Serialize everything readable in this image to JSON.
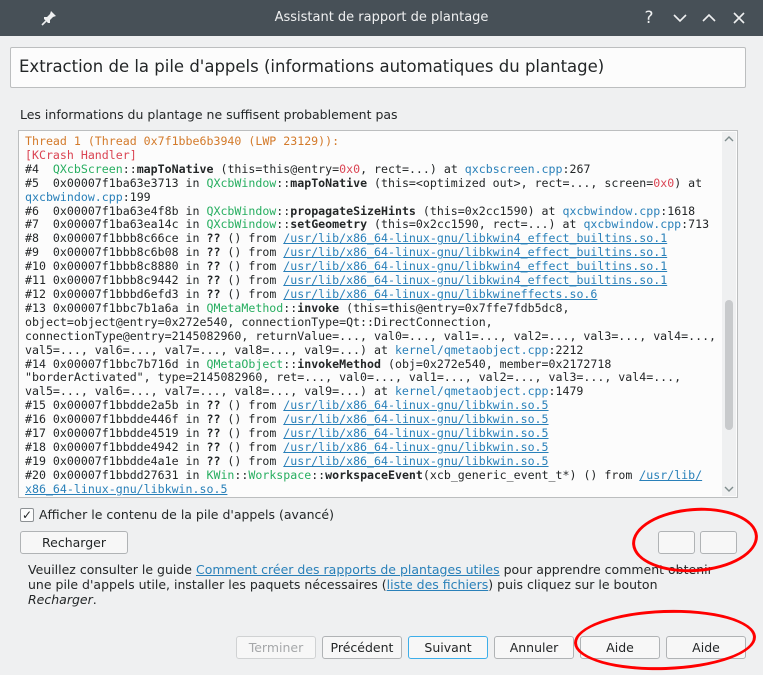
{
  "window": {
    "title": "Assistant de rapport de plantage",
    "help_glyph": "?",
    "pin_icon": "pin-icon",
    "minimize_icon": "chevron-down-icon",
    "maximize_icon": "chevron-up-icon",
    "close_icon": "close-icon"
  },
  "header": {
    "title": "Extraction de la pile d'appels (informations automatiques du plantage)"
  },
  "intro": "Les informations du plantage ne suffisent probablement pas",
  "backtrace": [
    [
      {
        "t": "Thread 1 (Thread 0x7f1bbe6b3940 (LWP 23129)):",
        "c": "orange"
      }
    ],
    [
      {
        "t": "[KCrash Handler]",
        "c": "red"
      }
    ],
    [
      {
        "t": "#4  "
      },
      {
        "t": "QXcbScreen",
        "c": "green"
      },
      {
        "t": "::"
      },
      {
        "t": "mapToNative",
        "c": "bold"
      },
      {
        "t": " (this=this@entry="
      },
      {
        "t": "0x0",
        "c": "red"
      },
      {
        "t": ", rect=...) at "
      },
      {
        "t": "qxcbscreen.cpp",
        "c": "blue"
      },
      {
        "t": ":267"
      }
    ],
    [
      {
        "t": "#5  0x00007f1ba63e3713 in "
      },
      {
        "t": "QXcbWindow",
        "c": "green"
      },
      {
        "t": "::"
      },
      {
        "t": "mapToNative",
        "c": "bold"
      },
      {
        "t": " (this=<optimized out>, rect=..., screen="
      },
      {
        "t": "0x0",
        "c": "red"
      },
      {
        "t": ") at"
      }
    ],
    [
      {
        "t": "qxcbwindow.cpp",
        "c": "blue"
      },
      {
        "t": ":199"
      }
    ],
    [
      {
        "t": "#6  0x00007f1ba63e4f8b in "
      },
      {
        "t": "QXcbWindow",
        "c": "green"
      },
      {
        "t": "::"
      },
      {
        "t": "propagateSizeHints",
        "c": "bold"
      },
      {
        "t": " (this=0x2cc1590) at "
      },
      {
        "t": "qxcbwindow.cpp",
        "c": "blue"
      },
      {
        "t": ":1618"
      }
    ],
    [
      {
        "t": "#7  0x00007f1ba63ea14c in "
      },
      {
        "t": "QXcbWindow",
        "c": "green"
      },
      {
        "t": "::"
      },
      {
        "t": "setGeometry",
        "c": "bold"
      },
      {
        "t": " (this=0x2cc1590, rect=...) at "
      },
      {
        "t": "qxcbwindow.cpp",
        "c": "blue"
      },
      {
        "t": ":713"
      }
    ],
    [
      {
        "t": "#8  0x00007f1bbb8c66ce in "
      },
      {
        "t": "??",
        "c": "bold"
      },
      {
        "t": " () from "
      },
      {
        "t": "/usr/lib/x86_64-linux-gnu/libkwin4_effect_builtins.so.1",
        "c": "path"
      }
    ],
    [
      {
        "t": "#9  0x00007f1bbb8c6b08 in "
      },
      {
        "t": "??",
        "c": "bold"
      },
      {
        "t": " () from "
      },
      {
        "t": "/usr/lib/x86_64-linux-gnu/libkwin4_effect_builtins.so.1",
        "c": "path"
      }
    ],
    [
      {
        "t": "#10 0x00007f1bbb8c8880 in "
      },
      {
        "t": "??",
        "c": "bold"
      },
      {
        "t": " () from "
      },
      {
        "t": "/usr/lib/x86_64-linux-gnu/libkwin4_effect_builtins.so.1",
        "c": "path"
      }
    ],
    [
      {
        "t": "#11 0x00007f1bbb8c9442 in "
      },
      {
        "t": "??",
        "c": "bold"
      },
      {
        "t": " () from "
      },
      {
        "t": "/usr/lib/x86_64-linux-gnu/libkwin4_effect_builtins.so.1",
        "c": "path"
      }
    ],
    [
      {
        "t": "#12 0x00007f1bbbd6efd3 in "
      },
      {
        "t": "??",
        "c": "bold"
      },
      {
        "t": " () from "
      },
      {
        "t": "/usr/lib/x86_64-linux-gnu/libkwineffects.so.6",
        "c": "path"
      }
    ],
    [
      {
        "t": "#13 0x00007f1bbc7b1a6a in "
      },
      {
        "t": "QMetaMethod",
        "c": "green"
      },
      {
        "t": "::"
      },
      {
        "t": "invoke",
        "c": "bold"
      },
      {
        "t": " (this=this@entry=0x7ffe7fdb5dc8,"
      }
    ],
    [
      {
        "t": "object=object@entry=0x272e540, connectionType=Qt::DirectConnection,"
      }
    ],
    [
      {
        "t": "connectionType@entry=2145082960, returnValue=..., val0=..., val1=..., val2=..., val3=..., val4=...,"
      }
    ],
    [
      {
        "t": "val5=..., val6=..., val7=..., val8=..., val9=...) at "
      },
      {
        "t": "kernel/qmetaobject.cpp",
        "c": "blue"
      },
      {
        "t": ":2212"
      }
    ],
    [
      {
        "t": "#14 0x00007f1bbc7b716d in "
      },
      {
        "t": "QMetaObject",
        "c": "green"
      },
      {
        "t": "::"
      },
      {
        "t": "invokeMethod",
        "c": "bold"
      },
      {
        "t": " (obj=0x272e540, member=0x2172718"
      }
    ],
    [
      {
        "t": "\"borderActivated\", type=2145082960, ret=..., val0=..., val1=..., val2=..., val3=..., val4=...,"
      }
    ],
    [
      {
        "t": "val5=..., val6=..., val7=..., val8=..., val9=...) at "
      },
      {
        "t": "kernel/qmetaobject.cpp",
        "c": "blue"
      },
      {
        "t": ":1479"
      }
    ],
    [
      {
        "t": "#15 0x00007f1bbdde2a5b in "
      },
      {
        "t": "??",
        "c": "bold"
      },
      {
        "t": " () from "
      },
      {
        "t": "/usr/lib/x86_64-linux-gnu/libkwin.so.5",
        "c": "path"
      }
    ],
    [
      {
        "t": "#16 0x00007f1bbdde446f in "
      },
      {
        "t": "??",
        "c": "bold"
      },
      {
        "t": " () from "
      },
      {
        "t": "/usr/lib/x86_64-linux-gnu/libkwin.so.5",
        "c": "path"
      }
    ],
    [
      {
        "t": "#17 0x00007f1bbdde4519 in "
      },
      {
        "t": "??",
        "c": "bold"
      },
      {
        "t": " () from "
      },
      {
        "t": "/usr/lib/x86_64-linux-gnu/libkwin.so.5",
        "c": "path"
      }
    ],
    [
      {
        "t": "#18 0x00007f1bbdde4942 in "
      },
      {
        "t": "??",
        "c": "bold"
      },
      {
        "t": " () from "
      },
      {
        "t": "/usr/lib/x86_64-linux-gnu/libkwin.so.5",
        "c": "path"
      }
    ],
    [
      {
        "t": "#19 0x00007f1bbdde4a1e in "
      },
      {
        "t": "??",
        "c": "bold"
      },
      {
        "t": " () from "
      },
      {
        "t": "/usr/lib/x86_64-linux-gnu/libkwin.so.5",
        "c": "path"
      }
    ],
    [
      {
        "t": "#20 0x00007f1bbdd27631 in "
      },
      {
        "t": "KWin",
        "c": "green"
      },
      {
        "t": "::"
      },
      {
        "t": "Workspace",
        "c": "green"
      },
      {
        "t": "::"
      },
      {
        "t": "workspaceEvent",
        "c": "bold"
      },
      {
        "t": "(xcb_generic_event_t*) () from "
      },
      {
        "t": "/usr/lib/",
        "c": "path"
      }
    ],
    [
      {
        "t": "x86_64-linux-gnu/libkwin.so.5",
        "c": "path"
      }
    ]
  ],
  "colors": {
    "orange": "#d37a2a",
    "red": "#da4453",
    "green": "#27ae60",
    "blue": "#2980b9",
    "annotation_ring": "#ff0000"
  },
  "checkbox": {
    "label": "Afficher le contenu de la pile d'appels (avancé)",
    "checked": true,
    "check_glyph": "✓"
  },
  "reload_button": "Recharger",
  "guide": {
    "before": "Veuillez consulter le guide ",
    "link1": "Comment créer des rapports de plantages utiles",
    "middle1": " pour apprendre comment obtenir",
    "line2_before": "une pile d'appels utile, installer les paquets nécessaires (",
    "link2": "liste des fichiers",
    "line2_after": ") puis cliquez sur le bouton",
    "line3": "Recharger",
    "line3_after": "."
  },
  "footer": {
    "finish": "Terminer",
    "previous": "Précédent",
    "next": "Suivant",
    "cancel": "Annuler",
    "help1": "Aide",
    "help2": "Aide"
  }
}
